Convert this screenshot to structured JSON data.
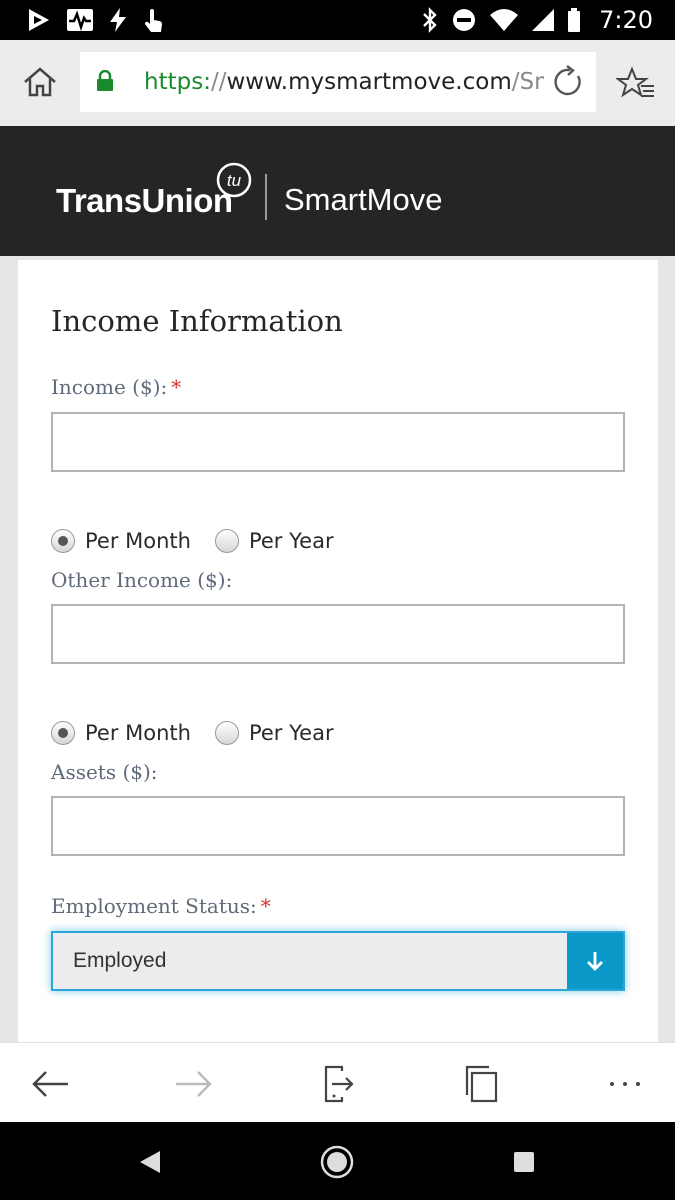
{
  "status_bar": {
    "time": "7:20",
    "icons": [
      "play-store-icon",
      "pulse-icon",
      "flash-icon",
      "touch-icon",
      "bluetooth-icon",
      "dnd-icon",
      "wifi-icon",
      "signal-icon",
      "battery-icon"
    ]
  },
  "browser": {
    "url_scheme": "https:",
    "url_sep": "//",
    "url_host": "www.mysmartmove.com",
    "url_path": "/Sma"
  },
  "header": {
    "brand": "TransUnion",
    "badge": "tu",
    "product": "SmartMove"
  },
  "form": {
    "title": "Income Information",
    "income": {
      "label": "Income ($):",
      "required": "*",
      "value": ""
    },
    "income_period": {
      "option1": "Per Month",
      "option2": "Per Year",
      "selected": "Per Month"
    },
    "other_income": {
      "label": "Other Income ($):",
      "value": ""
    },
    "other_income_period": {
      "option1": "Per Month",
      "option2": "Per Year",
      "selected": "Per Month"
    },
    "assets": {
      "label": "Assets ($):",
      "value": ""
    },
    "employment": {
      "label": "Employment Status:",
      "required": "*",
      "selected": "Employed"
    }
  },
  "colors": {
    "url_scheme": "#1b8a2e",
    "header_bg": "#252525",
    "required": "#d0312d",
    "select_accent": "#0a98c8"
  }
}
